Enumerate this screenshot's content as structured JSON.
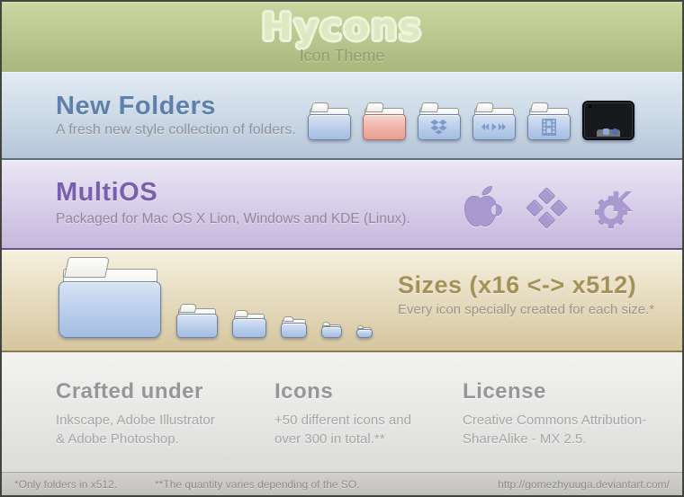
{
  "header": {
    "title": "Hycons",
    "subtitle": "Icon Theme"
  },
  "new_folders": {
    "title": "New Folders",
    "subtitle": "A fresh new style collection of folders.",
    "icons": [
      "plain-folder",
      "red-folder",
      "dropbox-folder",
      "media-folder",
      "video-folder",
      "desktop-screen"
    ]
  },
  "multios": {
    "title": "MultiOS",
    "subtitle": "Packaged for Mac OS X Lion, Windows and KDE (Linux).",
    "icons": [
      "apple-logo",
      "windows-logo",
      "kde-logo"
    ]
  },
  "sizes": {
    "title": "Sizes (x16 <-> x512)",
    "subtitle": "Every icon specially created for each size.*",
    "shown_sizes": [
      128,
      48,
      40,
      32,
      24,
      16
    ]
  },
  "info": {
    "columns": [
      {
        "title": "Crafted under",
        "body": "Inkscape, Adobe Illustrator\n& Adobe Photoshop."
      },
      {
        "title": "Icons",
        "body": "+50 different icons and\nover 300 in total.**"
      },
      {
        "title": "License",
        "body": "Creative Commons Attribution-\nShareAlike - MX 2.5."
      }
    ]
  },
  "footer": {
    "note1": "*Only folders in x512.",
    "note2": "**The quantity varies depending of the SO.",
    "url": "http://gomezhyuuga.deviantart.com/"
  },
  "colors": {
    "header_green": "#b8c58c",
    "band_blue": "#c9d7e6",
    "band_purple": "#d6cbe8",
    "band_tan": "#e5d9b8",
    "band_gray": "#e8e8e6",
    "title_blue": "#5d81aa",
    "title_purple": "#7a5fae",
    "title_tan": "#a39157",
    "folder_blue": "#b9cdea",
    "folder_red": "#f0b1a7",
    "os_icon_purple": "#a89ace"
  }
}
